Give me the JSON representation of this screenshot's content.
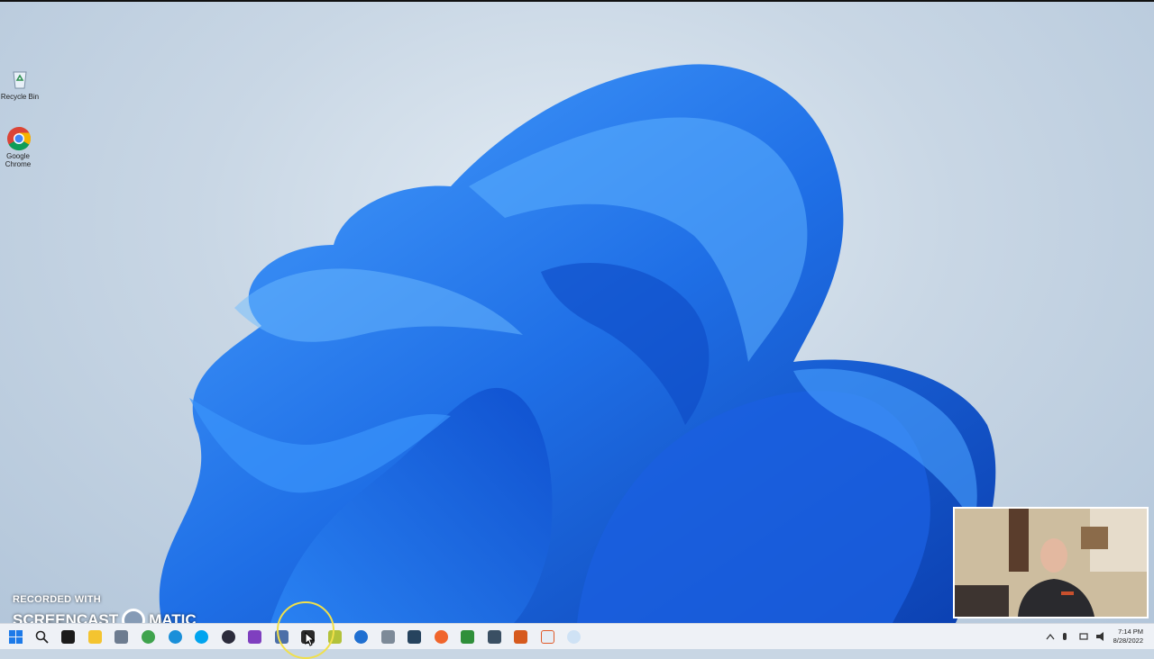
{
  "desktop": {
    "icons": [
      {
        "name": "recycle-bin",
        "label": "Recycle Bin"
      },
      {
        "name": "google-chrome",
        "label": "Google Chrome"
      }
    ]
  },
  "watermark": {
    "line1": "RECORDED WITH",
    "brand_left": "SCREENCAST",
    "brand_right": "MATIC"
  },
  "taskbar": {
    "pinned_icons": [
      "windows-start-icon",
      "search-icon",
      "terminal-icon",
      "file-explorer-icon",
      "app-icon",
      "app-icon",
      "edge-icon",
      "skype-icon",
      "app-icon",
      "visual-studio-icon",
      "app-icon",
      "app-icon",
      "app-icon",
      "maps-icon",
      "app-icon",
      "app-icon",
      "app-icon",
      "app-icon",
      "app-icon",
      "app-icon",
      "app-icon",
      "app-icon"
    ],
    "tray": {
      "clock_time": "7:14 PM",
      "clock_date": "8/28/2022"
    }
  }
}
